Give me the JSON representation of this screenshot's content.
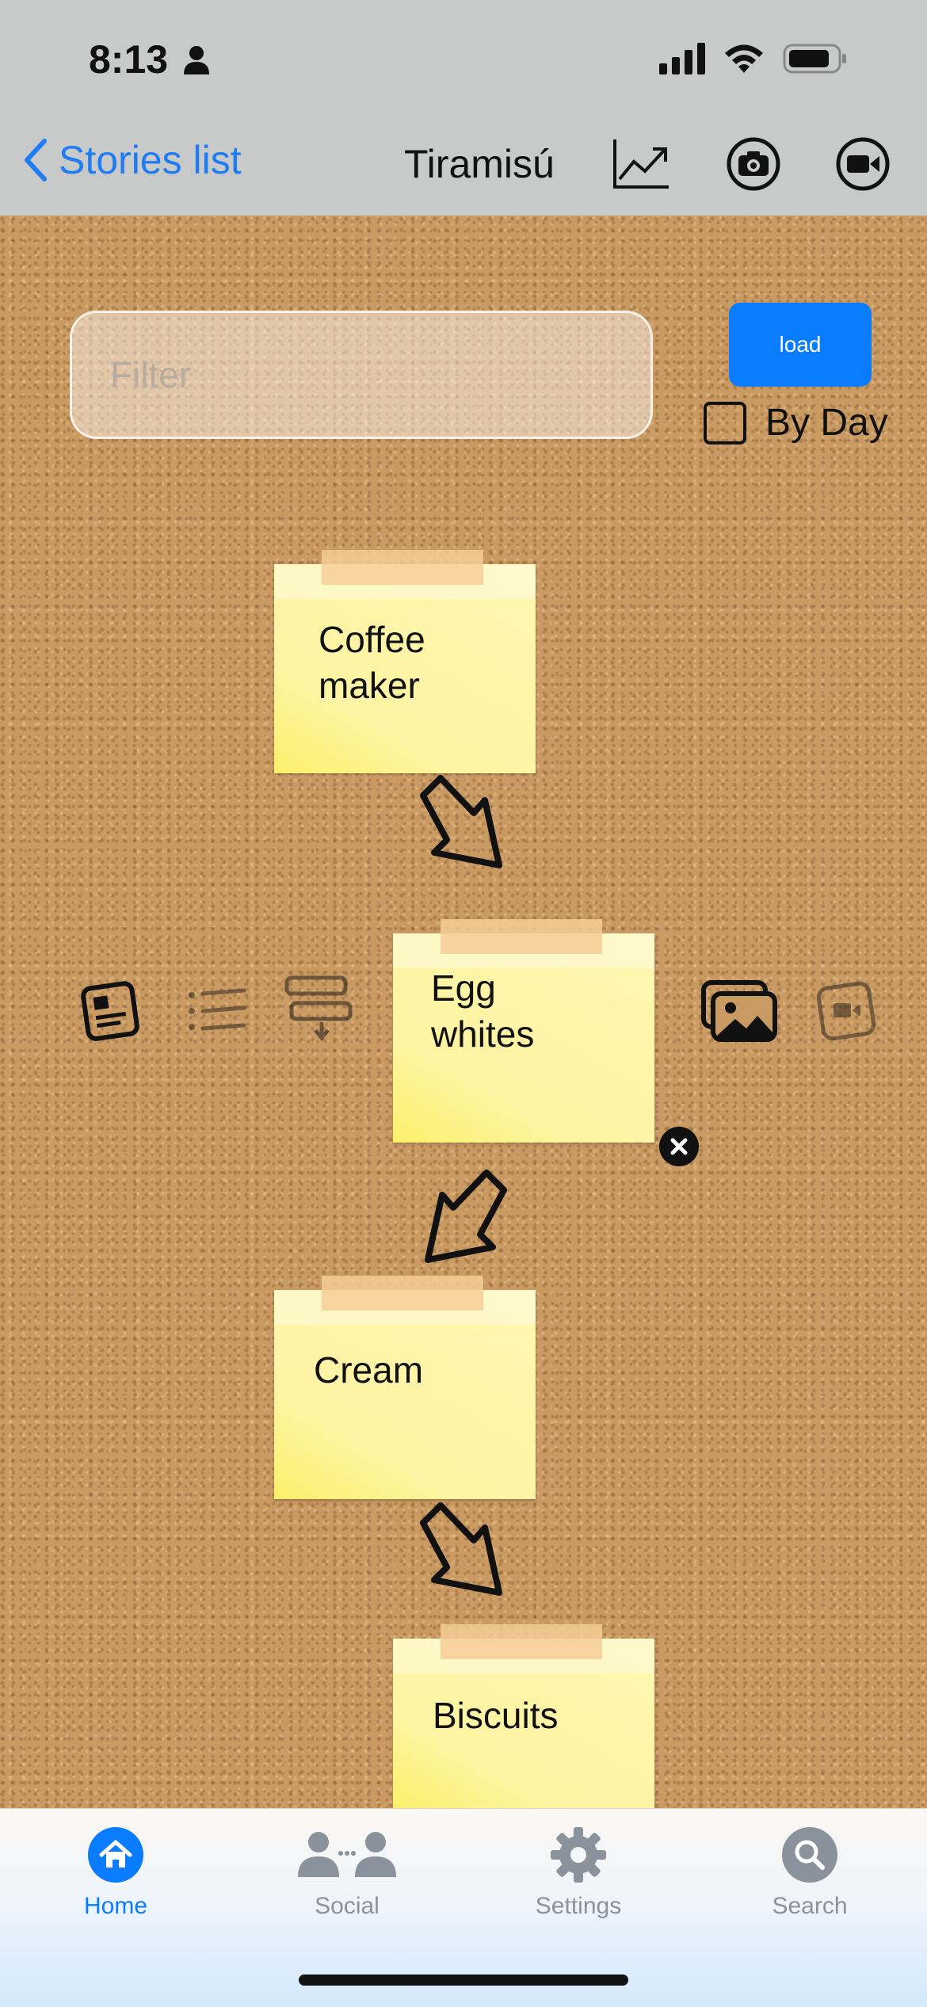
{
  "status": {
    "time": "8:13"
  },
  "nav": {
    "back_label": "Stories list",
    "title": "Tiramisú",
    "icons": [
      "chart-icon",
      "camera-icon",
      "video-icon"
    ]
  },
  "controls": {
    "filter_placeholder": "Filter",
    "load_label": "load",
    "by_day_label": "By Day",
    "by_day_checked": false
  },
  "notes": [
    {
      "text": "Coffee\nmaker"
    },
    {
      "text": "Egg\nwhites"
    },
    {
      "text": "Cream"
    },
    {
      "text": "Biscuits"
    }
  ],
  "side_icons": [
    "story-card-icon",
    "list-icon",
    "move-down-icon",
    "photos-icon",
    "video-frame-icon"
  ],
  "tabs": [
    {
      "label": "Home",
      "active": true
    },
    {
      "label": "Social",
      "active": false
    },
    {
      "label": "Settings",
      "active": false
    },
    {
      "label": "Search",
      "active": false
    }
  ],
  "colors": {
    "accent": "#0a7cff",
    "tab_inactive": "#8a929b",
    "note": "#fdf4a3",
    "cork": "#c99a62"
  }
}
